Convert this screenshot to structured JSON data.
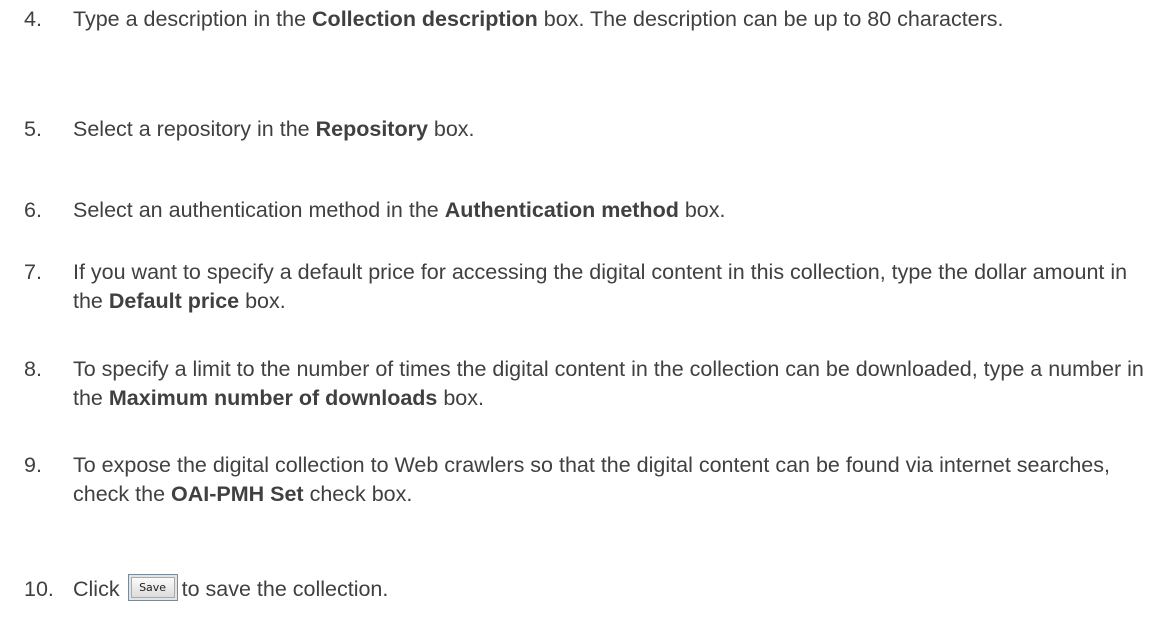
{
  "steps": [
    {
      "number": "4.",
      "parts": [
        "Type a description in the ",
        "Collection description",
        " box. The description can be up to 80 characters."
      ]
    },
    {
      "number": "5.",
      "parts": [
        "Select a repository in the ",
        "Repository",
        " box."
      ]
    },
    {
      "number": "6.",
      "parts": [
        "Select an authentication method in the ",
        "Authentication method",
        " box."
      ]
    },
    {
      "number": "7.",
      "parts": [
        "If you want to specify a default price for accessing the digital content in this collection, type the dollar amount in the ",
        "Default price",
        " box."
      ]
    },
    {
      "number": "8.",
      "parts": [
        "To specify a limit to the number of times the digital content in the collection can be downloaded, type a number in the ",
        "Maximum number of downloads",
        " box."
      ]
    },
    {
      "number": "9.",
      "parts": [
        "To expose the digital collection to Web crawlers so that the digital content can be found via internet searches, check the ",
        "OAI-PMH Set",
        " check box."
      ]
    },
    {
      "number": "10.",
      "before": "Click",
      "button_label": "Save",
      "after": "to save the collection."
    }
  ]
}
